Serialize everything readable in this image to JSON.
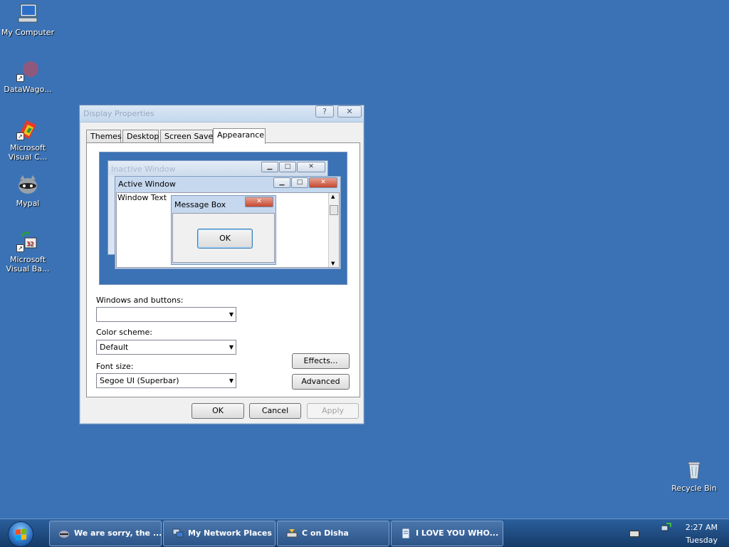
{
  "desktop": {
    "icons": {
      "my_computer": "My Computer",
      "datawagon": "DataWago...",
      "ms_visual_c": "Microsoft Visual C...",
      "mypal": "Mypal",
      "ms_visual_ba": "Microsoft Visual Ba...",
      "recycle_bin": "Recycle Bin"
    }
  },
  "dialog": {
    "title": "Display Properties",
    "help_button": "?",
    "close_button": "✕",
    "tabs": [
      "Themes",
      "Desktop",
      "Screen Saver",
      "Appearance"
    ],
    "active_tab": "Appearance",
    "preview": {
      "inactive_window": "Inactive Window",
      "active_window": "Active Window",
      "window_text": "Window Text",
      "message_box": "Message Box",
      "ok": "OK"
    },
    "windows_buttons_label": "Windows and buttons:",
    "windows_buttons_value": "",
    "color_scheme_label": "Color scheme:",
    "color_scheme_value": "Default",
    "font_size_label": "Font size:",
    "font_size_value": "Segoe UI (Superbar)",
    "effects_button": "Effects...",
    "advanced_button": "Advanced",
    "ok_button": "OK",
    "cancel_button": "Cancel",
    "apply_button": "Apply"
  },
  "taskbar": {
    "buttons": [
      {
        "label": "We are sorry, the ...",
        "icon": "raccoon-icon"
      },
      {
        "label": "My Network Places",
        "icon": "network-places-icon"
      },
      {
        "label": "C on Disha",
        "icon": "drive-icon"
      },
      {
        "label": "I LOVE YOU WHO...",
        "icon": "document-icon"
      }
    ],
    "clock_time": "2:27 AM",
    "clock_day": "Tuesday"
  },
  "colors": {
    "desktop_background": "#3a72b5",
    "taskbar": "#1d4677"
  }
}
